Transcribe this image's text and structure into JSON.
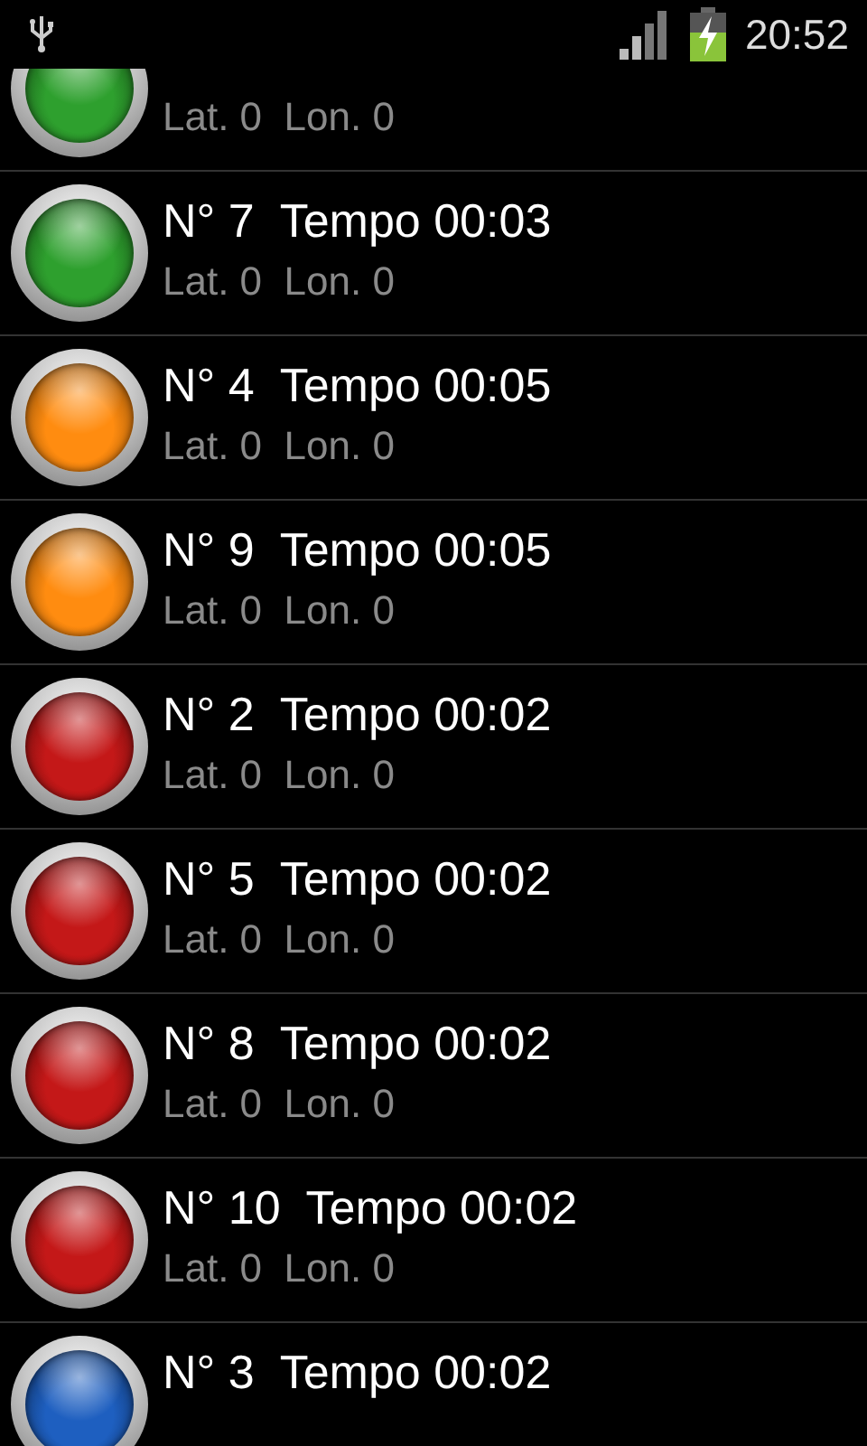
{
  "status_bar": {
    "time": "20:52"
  },
  "rows": [
    {
      "color": "#2ea02e",
      "location": "Lat. 0  Lon. 0"
    },
    {
      "color": "#2ea02e",
      "title": "N° 7  Tempo 00:03",
      "location": "Lat. 0  Lon. 0"
    },
    {
      "color": "#ff8c10",
      "title": "N° 4  Tempo 00:05",
      "location": "Lat. 0  Lon. 0"
    },
    {
      "color": "#ff8c10",
      "title": "N° 9  Tempo 00:05",
      "location": "Lat. 0  Lon. 0"
    },
    {
      "color": "#c41818",
      "title": "N° 2  Tempo 00:02",
      "location": "Lat. 0  Lon. 0"
    },
    {
      "color": "#c41818",
      "title": "N° 5  Tempo 00:02",
      "location": "Lat. 0  Lon. 0"
    },
    {
      "color": "#c41818",
      "title": "N° 8  Tempo 00:02",
      "location": "Lat. 0  Lon. 0"
    },
    {
      "color": "#c41818",
      "title": "N° 10  Tempo 00:02",
      "location": "Lat. 0  Lon. 0"
    },
    {
      "color": "#1e5fc0",
      "title": "N° 3  Tempo 00:02"
    }
  ]
}
